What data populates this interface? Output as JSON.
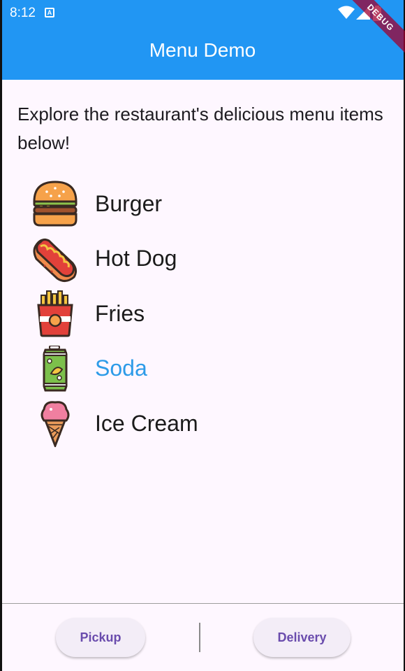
{
  "status_bar": {
    "time": "8:12",
    "notification_icon": "a-icon",
    "icons": [
      "wifi-icon",
      "signal-icon",
      "battery-icon"
    ]
  },
  "debug_banner": "DEBUG",
  "app_bar": {
    "title": "Menu Demo",
    "color": "#2196f3"
  },
  "intro_text": "Explore the restaurant's delicious menu items below!",
  "menu": {
    "items": [
      {
        "label": "Burger",
        "icon": "burger-icon",
        "selected": false
      },
      {
        "label": "Hot Dog",
        "icon": "hot-dog-icon",
        "selected": false
      },
      {
        "label": "Fries",
        "icon": "fries-icon",
        "selected": false
      },
      {
        "label": "Soda",
        "icon": "soda-icon",
        "selected": true
      },
      {
        "label": "Ice Cream",
        "icon": "ice-cream-icon",
        "selected": false
      }
    ],
    "selected_color": "#2d9be8"
  },
  "bottom_bar": {
    "pickup_label": "Pickup",
    "delivery_label": "Delivery",
    "accent": "#6a4cad"
  }
}
